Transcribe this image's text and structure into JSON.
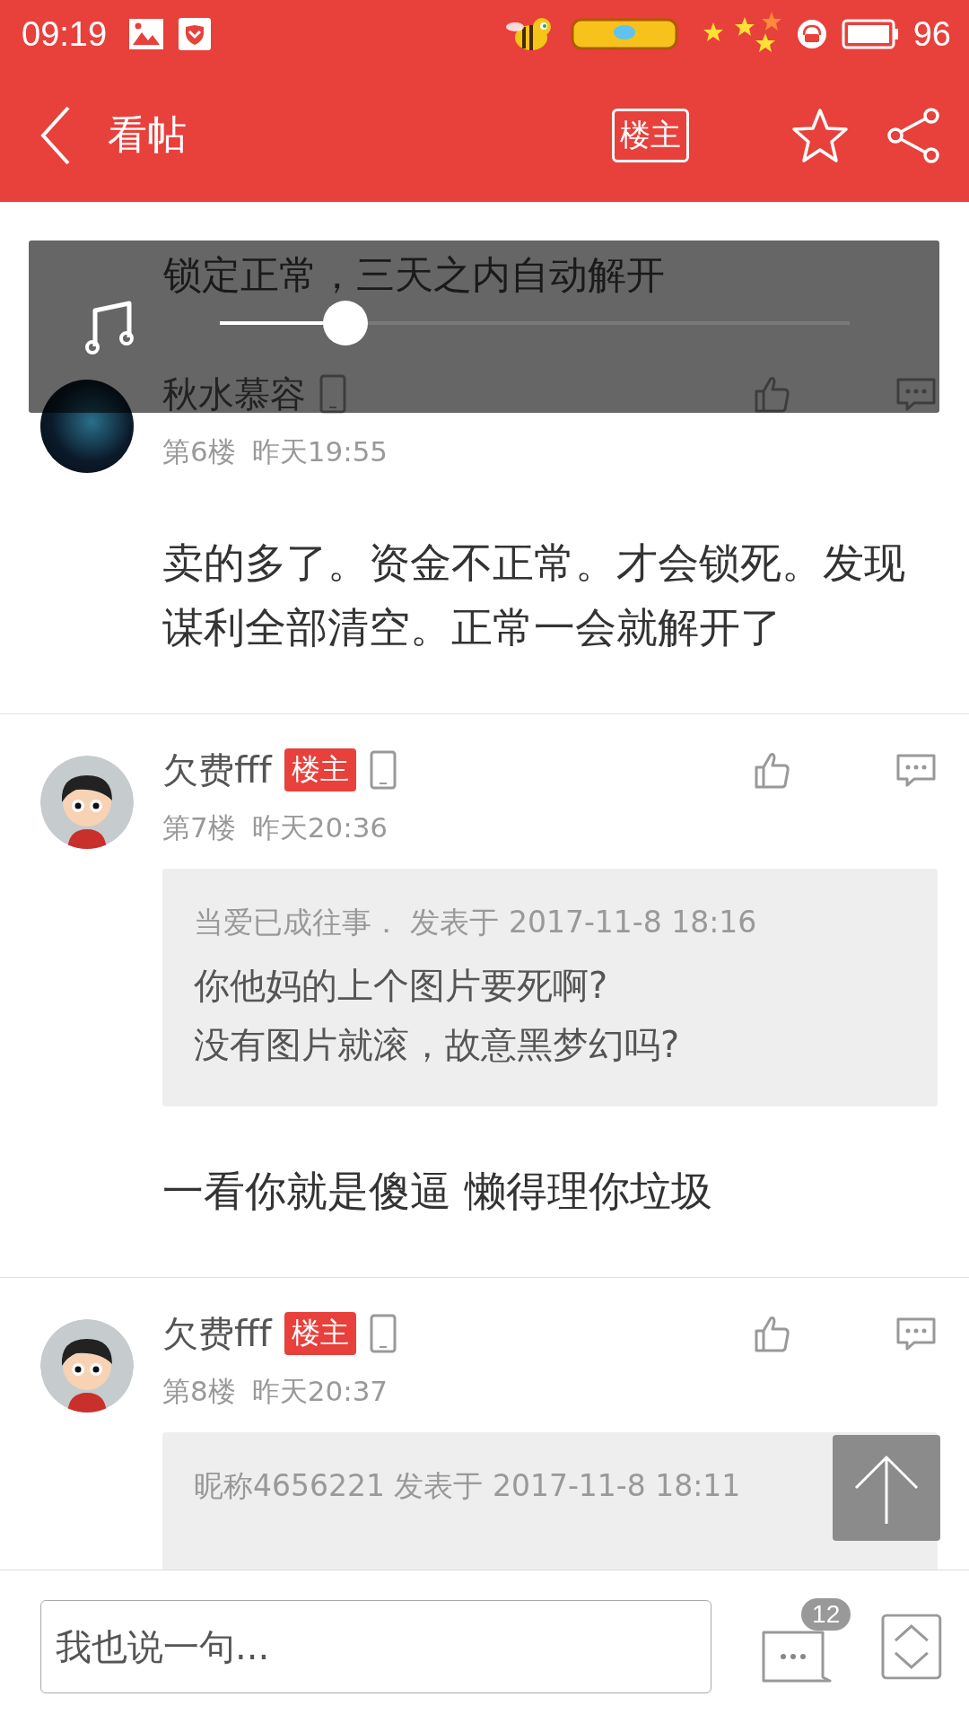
{
  "status_bar": {
    "time": "09:19",
    "battery": "96"
  },
  "app_bar": {
    "title": "看帖",
    "op_filter": "楼主"
  },
  "posts": [
    {
      "name": "秋水慕容",
      "avatar": {
        "kind": "photo"
      },
      "floor": "第6楼",
      "time": "昨天19:55",
      "body": "卖的多了。资金不正常。才会锁死。发现谋利全部清空。正常一会就解开了"
    },
    {
      "name": "欠费fff",
      "badge": "楼主",
      "avatar": {
        "kind": "cartoon"
      },
      "floor": "第7楼",
      "time": "昨天20:36",
      "quote": {
        "header": "当爱已成往事．  发表于 2017-11-8 18:16",
        "lines": [
          "你他妈的上个图片要死啊?",
          "没有图片就滚，故意黑梦幻吗?"
        ]
      },
      "body": "一看你就是傻逼 懒得理你垃圾"
    },
    {
      "name": "欠费fff",
      "badge": "楼主",
      "avatar": {
        "kind": "cartoon"
      },
      "floor": "第8楼",
      "time": "昨天20:37",
      "quote": {
        "header": "昵称4656221 发表于 2017-11-8 18:11"
      }
    }
  ],
  "music_player": {
    "title": "锁定正常，三天之内自动解开",
    "level": 0.2
  },
  "bottom_bar": {
    "placeholder": "我也说一句...",
    "comment_count": "12"
  }
}
